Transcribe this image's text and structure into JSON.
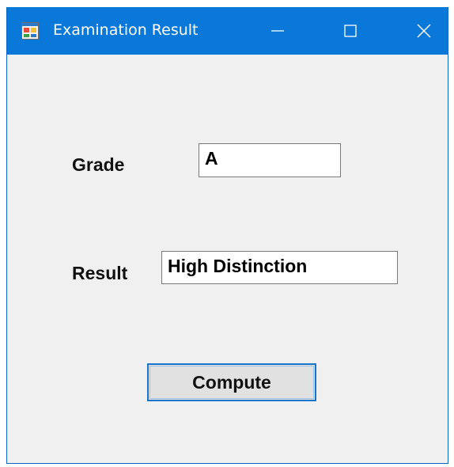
{
  "window": {
    "title": "Examination Result",
    "title_bar_color": "#0978d8",
    "background_color": "#f0f0f0",
    "controls": {
      "minimize_icon": "minimize-icon",
      "maximize_icon": "maximize-icon",
      "close_icon": "close-icon"
    },
    "app_icon": "form-window-icon"
  },
  "form": {
    "grade_label": "Grade",
    "grade_value": "A",
    "result_label": "Result",
    "result_value": "High Distinction",
    "compute_label": "Compute",
    "button_focus_color": "#1a74c9"
  }
}
